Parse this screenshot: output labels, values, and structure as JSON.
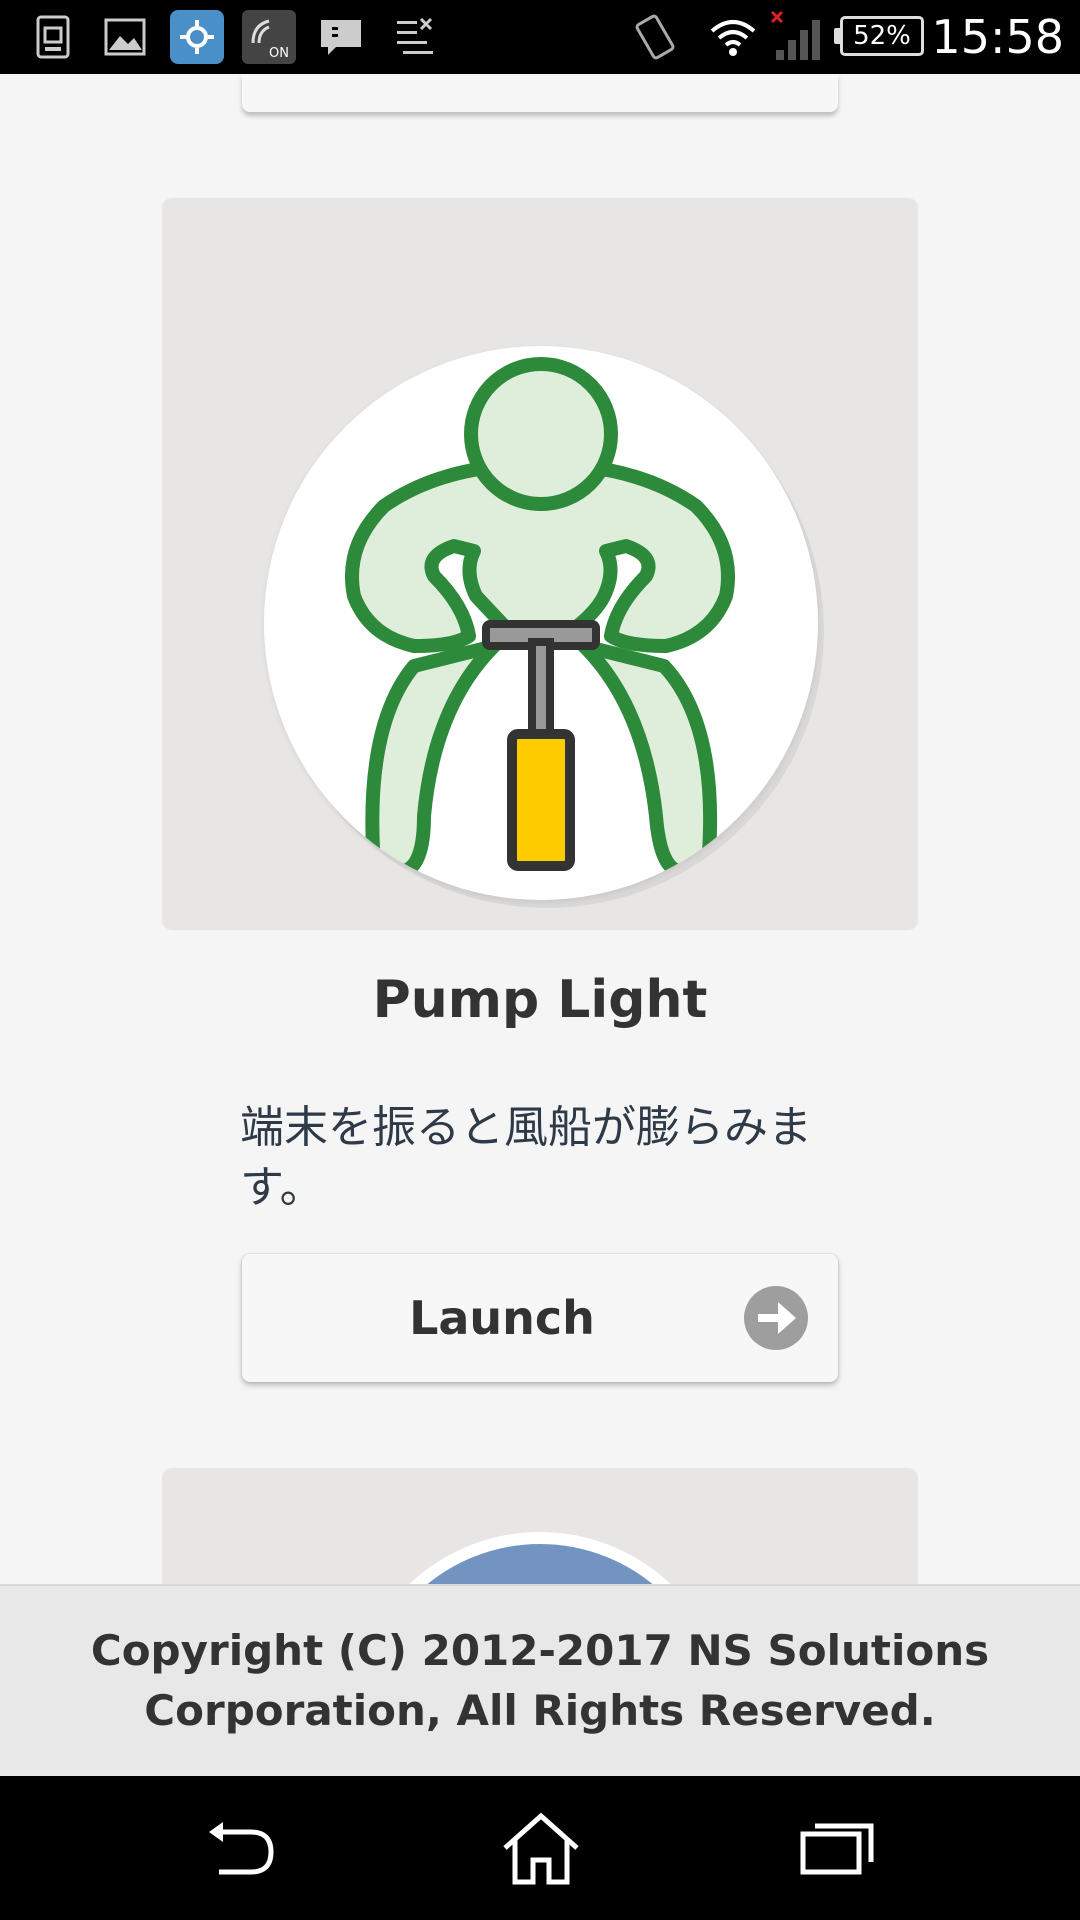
{
  "status_bar": {
    "icons": [
      "sim-card-icon",
      "gallery-icon",
      "settings-app-icon",
      "nfc-on-icon",
      "message-icon",
      "task-list-icon"
    ],
    "right_icons": [
      "vibrate-icon",
      "wifi-icon",
      "signal-no-service-icon"
    ],
    "battery": "52%",
    "time": "15:58"
  },
  "card": {
    "title": "Pump Light",
    "description": "端末を振ると風船が膨らみます。",
    "launch_label": "Launch",
    "image_icon": "person-pump-icon"
  },
  "footer": {
    "copyright": "Copyright (C) 2012-2017 NS Solutions Corporation, All Rights Reserved."
  },
  "nav": {
    "back": "back-icon",
    "home": "home-icon",
    "recents": "recents-icon"
  },
  "colors": {
    "card_bg": "#e7e6e5",
    "figure_stroke": "#2e8a3b",
    "figure_fill": "#deeedb",
    "pump_handle": "#ffcc00",
    "next_card_circle": "#7394c0"
  }
}
